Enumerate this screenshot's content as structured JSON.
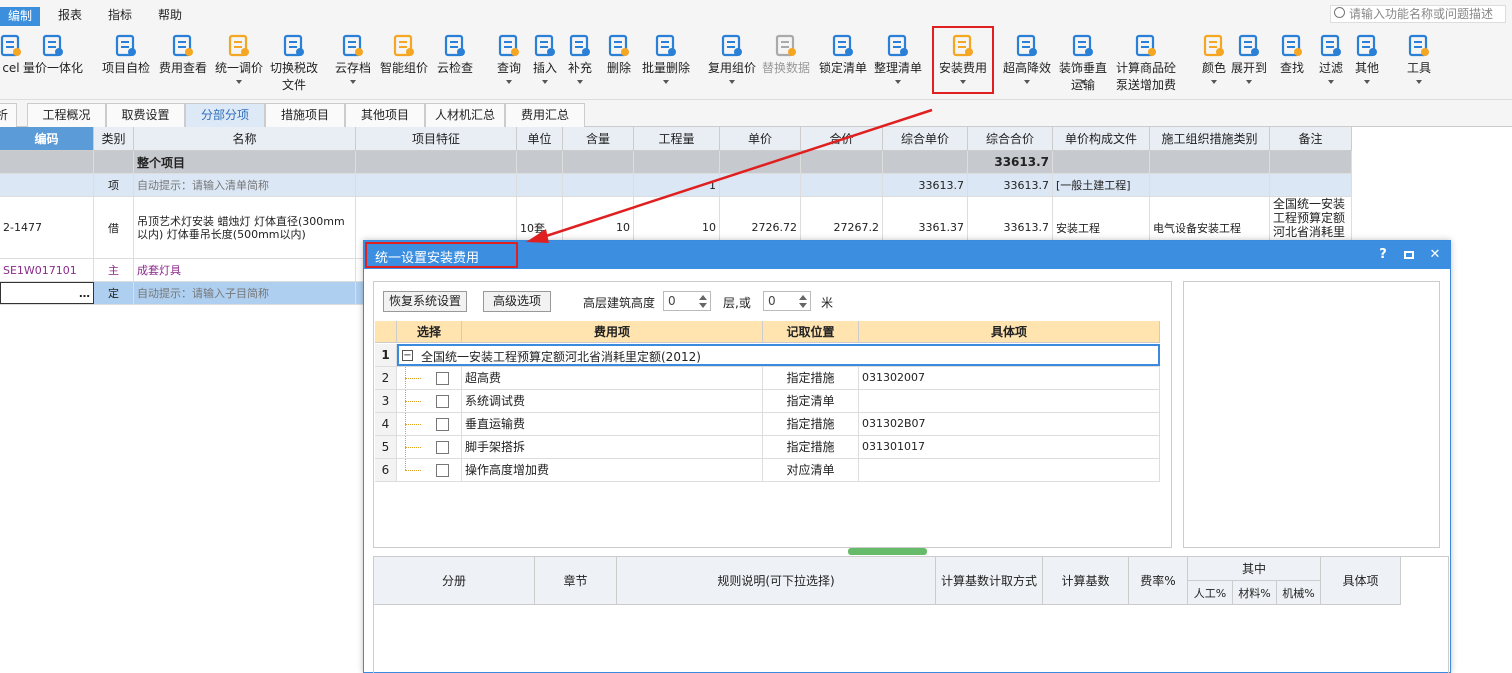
{
  "menubar": {
    "items": [
      "编制",
      "报表",
      "指标",
      "帮助"
    ],
    "search_placeholder": "请输入功能名称或问题描述"
  },
  "ribbon": {
    "buttons": [
      {
        "label": "cel",
        "icon": "excel-icon"
      },
      {
        "label": "量价一体化",
        "icon": "price-integration-icon"
      },
      {
        "label": "项目自检",
        "icon": "project-check-icon"
      },
      {
        "label": "费用查看",
        "icon": "fee-view-icon"
      },
      {
        "label": "统一调价",
        "icon": "unify-price-icon"
      },
      {
        "label": "切换税改\n文件",
        "icon": "tax-switch-icon"
      },
      {
        "label": "云存档",
        "icon": "cloud-save-icon"
      },
      {
        "label": "智能组价",
        "icon": "smart-price-icon"
      },
      {
        "label": "云检查",
        "icon": "cloud-check-icon"
      },
      {
        "label": "查询",
        "icon": "query-icon"
      },
      {
        "label": "插入",
        "icon": "insert-icon"
      },
      {
        "label": "补充",
        "icon": "supplement-icon"
      },
      {
        "label": "删除",
        "icon": "delete-icon"
      },
      {
        "label": "批量删除",
        "icon": "batch-delete-icon"
      },
      {
        "label": "复用组价",
        "icon": "reuse-price-icon"
      },
      {
        "label": "替换数据",
        "icon": "replace-data-icon"
      },
      {
        "label": "锁定清单",
        "icon": "lock-list-icon"
      },
      {
        "label": "整理清单",
        "icon": "organize-list-icon"
      },
      {
        "label": "安装费用",
        "icon": "install-fee-icon"
      },
      {
        "label": "超高降效",
        "icon": "high-efficiency-icon"
      },
      {
        "label": "装饰垂直\n运输",
        "icon": "vertical-transport-icon"
      },
      {
        "label": "计算商品砼\n泵送增加费",
        "icon": "concrete-pump-icon"
      },
      {
        "label": "颜色",
        "icon": "color-icon"
      },
      {
        "label": "展开到",
        "icon": "expand-icon"
      },
      {
        "label": "查找",
        "icon": "find-icon"
      },
      {
        "label": "过滤",
        "icon": "filter-icon"
      },
      {
        "label": "其他",
        "icon": "other-icon"
      },
      {
        "label": "工具",
        "icon": "tool-icon"
      }
    ]
  },
  "tabs": [
    "析",
    "工程概况",
    "取费设置",
    "分部分项",
    "措施项目",
    "其他项目",
    "人材机汇总",
    "费用汇总"
  ],
  "grid": {
    "headers": [
      "编码",
      "类别",
      "名称",
      "项目特征",
      "单位",
      "含量",
      "工程量",
      "单价",
      "合价",
      "综合单价",
      "综合合价",
      "单价构成文件",
      "施工组织措施类别",
      "备注"
    ],
    "rows": [
      {
        "code": "",
        "type": "",
        "name": "整个项目",
        "feature": "",
        "unit": "",
        "content": "",
        "qty": "",
        "price": "",
        "total": "",
        "comp_price": "",
        "comp_total": "33613.7",
        "file": "",
        "measure": "",
        "note": ""
      },
      {
        "code": "",
        "type": "项",
        "name": "自动提示：请输入清单简称",
        "feature": "",
        "unit": "",
        "content": "",
        "qty": "1",
        "price": "",
        "total": "",
        "comp_price": "33613.7",
        "comp_total": "33613.7",
        "file": "[一般土建工程]",
        "measure": "",
        "note": ""
      },
      {
        "code": "2-1477",
        "type": "借",
        "name": "吊顶艺术灯安装 蜡烛灯 灯体直径(300mm以内) 灯体垂吊长度(500mm以内)",
        "feature": "",
        "unit": "10套",
        "content": "10",
        "qty": "10",
        "price": "2726.72",
        "total": "27267.2",
        "comp_price": "3361.37",
        "comp_total": "33613.7",
        "file": "安装工程",
        "measure": "电气设备安装工程",
        "note": "全国统一安装工程预算定额河北省消耗里"
      },
      {
        "code": "SE1W017101",
        "type": "主",
        "name": "成套灯具",
        "feature": "",
        "unit": "",
        "content": "",
        "qty": "",
        "price": "",
        "total": "",
        "comp_price": "",
        "comp_total": "",
        "file": "",
        "measure": "",
        "note": ""
      },
      {
        "code": "…",
        "type": "定",
        "name": "自动提示：请输入子目简称",
        "feature": "",
        "unit": "",
        "content": "",
        "qty": "",
        "price": "",
        "total": "",
        "comp_price": "",
        "comp_total": "",
        "file": "",
        "measure": "",
        "note": ""
      }
    ]
  },
  "dialog": {
    "title": "统一设置安装费用",
    "restore_button": "恢复系统设置",
    "advanced_button": "高级选项",
    "height_label": "高层建筑高度",
    "floor_value": "0",
    "floor_unit": "层,或",
    "meter_value": "0",
    "meter_unit": "米",
    "table_headers": [
      "选择",
      "费用项",
      "记取位置",
      "具体项"
    ],
    "table_rows": [
      {
        "num": "1",
        "name": "全国统一安装工程预算定额河北省消耗里定额(2012)",
        "position": "",
        "item": "",
        "group": true
      },
      {
        "num": "2",
        "name": "超高费",
        "position": "指定措施",
        "item": "031302007",
        "group": false
      },
      {
        "num": "3",
        "name": "系统调试费",
        "position": "指定清单",
        "item": "",
        "group": false
      },
      {
        "num": "4",
        "name": "垂直运输费",
        "position": "指定措施",
        "item": "031302B07",
        "group": false
      },
      {
        "num": "5",
        "name": "脚手架搭拆",
        "position": "指定措施",
        "item": "031301017",
        "group": false
      },
      {
        "num": "6",
        "name": "操作高度增加费",
        "position": "对应清单",
        "item": "",
        "group": false
      }
    ],
    "bottom_headers": {
      "fence": "分册",
      "chapter": "章节",
      "rule": "规则说明(可下拉选择)",
      "calc_method": "计算基数计取方式",
      "calc_base": "计算基数",
      "rate": "费率%",
      "among": "其中",
      "labor": "人工%",
      "material": "材料%",
      "machine": "机械%",
      "item": "具体项"
    }
  },
  "colors": {
    "accent": "#3c8fe0",
    "highlight": "#e02020",
    "fee_header": "#ffe4b0"
  }
}
